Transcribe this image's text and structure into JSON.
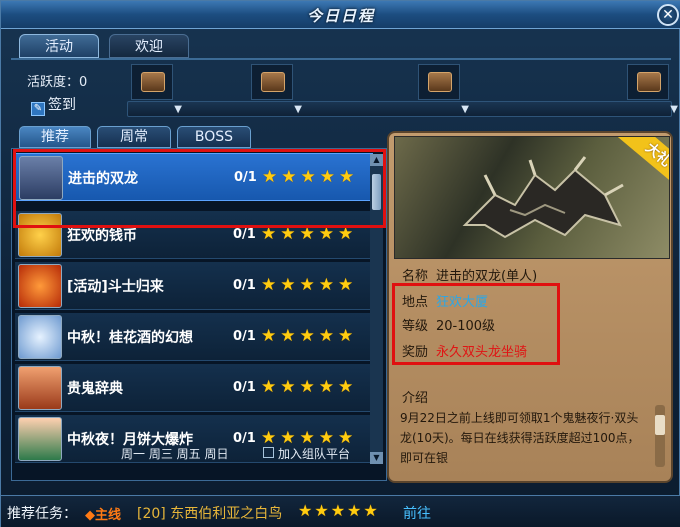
{
  "window": {
    "title": "今日日程"
  },
  "top_tabs": [
    "活动",
    "欢迎"
  ],
  "activity": {
    "label": "活跃度：0",
    "checkin": "签到"
  },
  "sub_tabs": [
    "推荐",
    "周常",
    "BOSS"
  ],
  "list": [
    {
      "name": "进击的双龙",
      "count": "0/1",
      "stars": 5
    },
    {
      "name": "狂欢的钱币",
      "count": "0/1",
      "stars": 5
    },
    {
      "name": "[活动]斗士归来",
      "count": "0/1",
      "stars": 5
    },
    {
      "name": "中秋！桂花酒的幻想",
      "count": "0/1",
      "stars": 5
    },
    {
      "name": "贵鬼辞典",
      "count": "0/1",
      "stars": 5
    },
    {
      "name": "中秋夜！月饼大爆炸",
      "count": "0/1",
      "stars": 5
    }
  ],
  "schedule_days": "周一 周三 周五 周日",
  "team_checkbox": "加入组队平台",
  "detail": {
    "gift_badge": "大礼",
    "name_label": "名称",
    "name_value": "进击的双龙(单人)",
    "location_label": "地点",
    "location_value": "狂欢大厦",
    "level_label": "等级",
    "level_value": "20-100级",
    "reward_label": "奖励",
    "reward_value": "永久双头龙坐骑",
    "intro_label": "介绍",
    "intro_text": "9月22日之前上线即可领取1个鬼魅夜行·双头龙(10天)。每日在线获得活跃度超过100点，即可在银"
  },
  "bottom": {
    "label": "推荐任务：",
    "tag": "主线",
    "quest": "[20] 东西伯利亚之白鸟",
    "stars": 5,
    "goto": "前往"
  },
  "colors": {
    "star": "#ffcc10",
    "highlight_box": "#e01010",
    "location": "#2aa7e8",
    "reward": "#e01414"
  }
}
